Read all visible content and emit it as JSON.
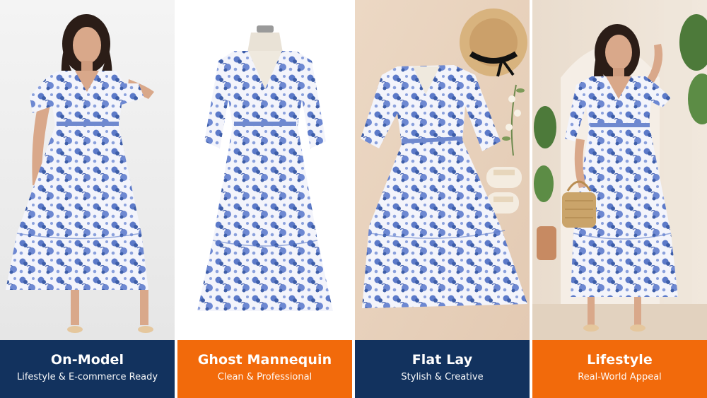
{
  "panels": [
    {
      "title": "On-Model",
      "subtitle": "Lifestyle & E-commerce Ready",
      "caption_color": "#12325e"
    },
    {
      "title": "Ghost Mannequin",
      "subtitle": "Clean & Professional",
      "caption_color": "#f26a0b"
    },
    {
      "title": "Flat Lay",
      "subtitle": "Stylish & Creative",
      "caption_color": "#12325e"
    },
    {
      "title": "Lifestyle",
      "subtitle": "Real-World Appeal",
      "caption_color": "#f26a0b"
    }
  ],
  "colors": {
    "dress_base": "#f3f4fb",
    "dress_print": "#5c7ac9",
    "navy": "#12325e",
    "orange": "#f26a0b"
  }
}
